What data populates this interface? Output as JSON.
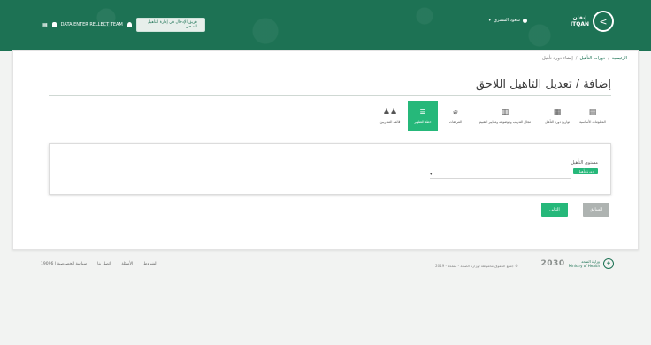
{
  "header": {
    "brand_mark": ">",
    "brand_name": "إتقان\nITQAN",
    "user_name": "سعود الشمري",
    "team_label": "DATA ENTER RELLECT TEAM",
    "role_select_value": "فريق الإدخال في إدارة التأهيل الصحي",
    "grid_icon": "grid-icon",
    "colors": {
      "primary": "#1d7254",
      "accent": "#26b87a"
    }
  },
  "breadcrumb": {
    "items": [
      "الرئيسية",
      "دورات التأهيل",
      "إنشاء دورة تأهيل"
    ],
    "separator": "/"
  },
  "page": {
    "title": "إضافة / تعديل التاهيل اللاحق"
  },
  "steps": [
    {
      "label": "المعلومات الأساسية",
      "icon": "info-icon",
      "glyph": "▤",
      "active": false
    },
    {
      "label": "تواريخ دورة التأهيل",
      "icon": "calendar-icon",
      "glyph": "▦",
      "active": false
    },
    {
      "label": "مجال التدريب وموضوعه ومعايير التقييم",
      "icon": "table-icon",
      "glyph": "▥",
      "active": false
    },
    {
      "label": "المرفقات",
      "icon": "paperclip-icon",
      "glyph": "⌀",
      "active": false
    },
    {
      "label": "خطة التطوير",
      "icon": "list-icon",
      "glyph": "≣",
      "active": true
    },
    {
      "label": "قائمة المتدربين",
      "icon": "users-icon",
      "glyph": "♟♟",
      "active": false
    }
  ],
  "form": {
    "field_label": "مستوى التأهيل",
    "field_tag": "دورة تأهيل",
    "select_value": "",
    "select_arrow": "▾"
  },
  "buttons": {
    "prev_label": "السابق",
    "next_label": "التالي"
  },
  "footer": {
    "ministry_name": "وزارة الصحة\nMinistry of Health",
    "vision_text": "2030",
    "copyright": "© جميع الحقوق محفوظة لوزارة الصحة - مملكة - 2019",
    "links": [
      "سياسة الخصوصية | 19096",
      "اتصل بنا",
      "الأسئلة",
      "الشروط"
    ]
  }
}
